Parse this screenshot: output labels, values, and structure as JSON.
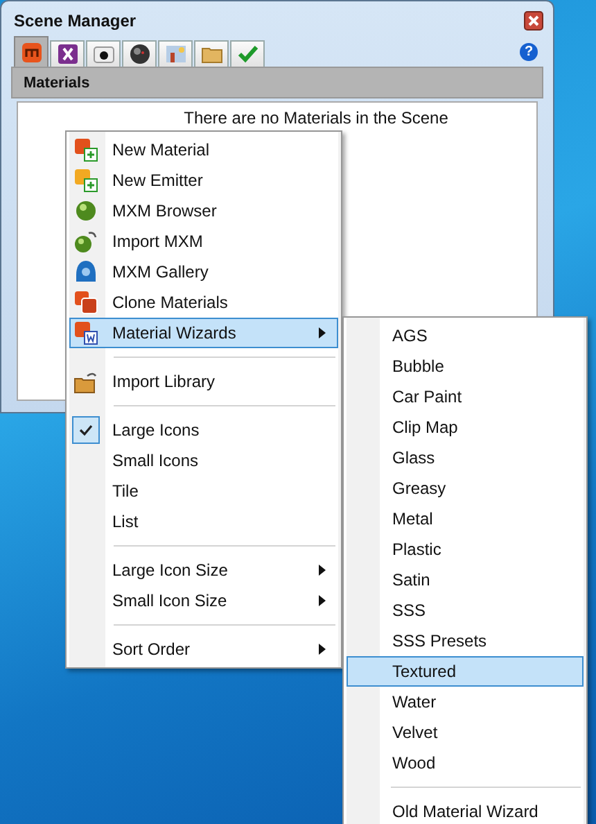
{
  "window": {
    "title": "Scene Manager",
    "help_button": "?"
  },
  "tabs": [
    {
      "selected": true
    },
    {
      "selected": false
    },
    {
      "selected": false
    },
    {
      "selected": false
    },
    {
      "selected": false
    },
    {
      "selected": false
    },
    {
      "selected": false
    }
  ],
  "panel": {
    "title": "Materials",
    "empty_message": "There are no Materials in the Scene"
  },
  "context_menu": {
    "items": [
      {
        "kind": "item",
        "label": "New Material",
        "checked": false,
        "has_submenu": false,
        "selected": false
      },
      {
        "kind": "item",
        "label": "New Emitter",
        "checked": false,
        "has_submenu": false,
        "selected": false
      },
      {
        "kind": "item",
        "label": "MXM Browser",
        "checked": false,
        "has_submenu": false,
        "selected": false
      },
      {
        "kind": "item",
        "label": "Import MXM",
        "checked": false,
        "has_submenu": false,
        "selected": false
      },
      {
        "kind": "item",
        "label": "MXM Gallery",
        "checked": false,
        "has_submenu": false,
        "selected": false
      },
      {
        "kind": "item",
        "label": "Clone Materials",
        "checked": false,
        "has_submenu": false,
        "selected": false
      },
      {
        "kind": "item",
        "label": "Material Wizards",
        "checked": false,
        "has_submenu": true,
        "selected": true
      },
      {
        "kind": "separator"
      },
      {
        "kind": "item",
        "label": "Import Library",
        "checked": false,
        "has_submenu": false,
        "selected": false
      },
      {
        "kind": "separator"
      },
      {
        "kind": "item",
        "label": "Large Icons",
        "checked": true,
        "has_submenu": false,
        "selected": false
      },
      {
        "kind": "item",
        "label": "Small Icons",
        "checked": false,
        "has_submenu": false,
        "selected": false
      },
      {
        "kind": "item",
        "label": "Tile",
        "checked": false,
        "has_submenu": false,
        "selected": false
      },
      {
        "kind": "item",
        "label": "List",
        "checked": false,
        "has_submenu": false,
        "selected": false
      },
      {
        "kind": "separator"
      },
      {
        "kind": "item",
        "label": "Large Icon Size",
        "checked": false,
        "has_submenu": true,
        "selected": false
      },
      {
        "kind": "item",
        "label": "Small Icon Size",
        "checked": false,
        "has_submenu": true,
        "selected": false
      },
      {
        "kind": "separator"
      },
      {
        "kind": "item",
        "label": "Sort Order",
        "checked": false,
        "has_submenu": true,
        "selected": false
      }
    ]
  },
  "submenu": {
    "items": [
      {
        "kind": "item",
        "label": "AGS",
        "selected": false
      },
      {
        "kind": "item",
        "label": "Bubble",
        "selected": false
      },
      {
        "kind": "item",
        "label": "Car Paint",
        "selected": false
      },
      {
        "kind": "item",
        "label": "Clip Map",
        "selected": false
      },
      {
        "kind": "item",
        "label": "Glass",
        "selected": false
      },
      {
        "kind": "item",
        "label": "Greasy",
        "selected": false
      },
      {
        "kind": "item",
        "label": "Metal",
        "selected": false
      },
      {
        "kind": "item",
        "label": "Plastic",
        "selected": false
      },
      {
        "kind": "item",
        "label": "Satin",
        "selected": false
      },
      {
        "kind": "item",
        "label": "SSS",
        "selected": false
      },
      {
        "kind": "item",
        "label": "SSS Presets",
        "selected": false
      },
      {
        "kind": "item",
        "label": "Textured",
        "selected": true
      },
      {
        "kind": "item",
        "label": "Water",
        "selected": false
      },
      {
        "kind": "item",
        "label": "Velvet",
        "selected": false
      },
      {
        "kind": "item",
        "label": "Wood",
        "selected": false
      },
      {
        "kind": "separator"
      },
      {
        "kind": "item",
        "label": "Old Material Wizard",
        "selected": false
      }
    ]
  }
}
